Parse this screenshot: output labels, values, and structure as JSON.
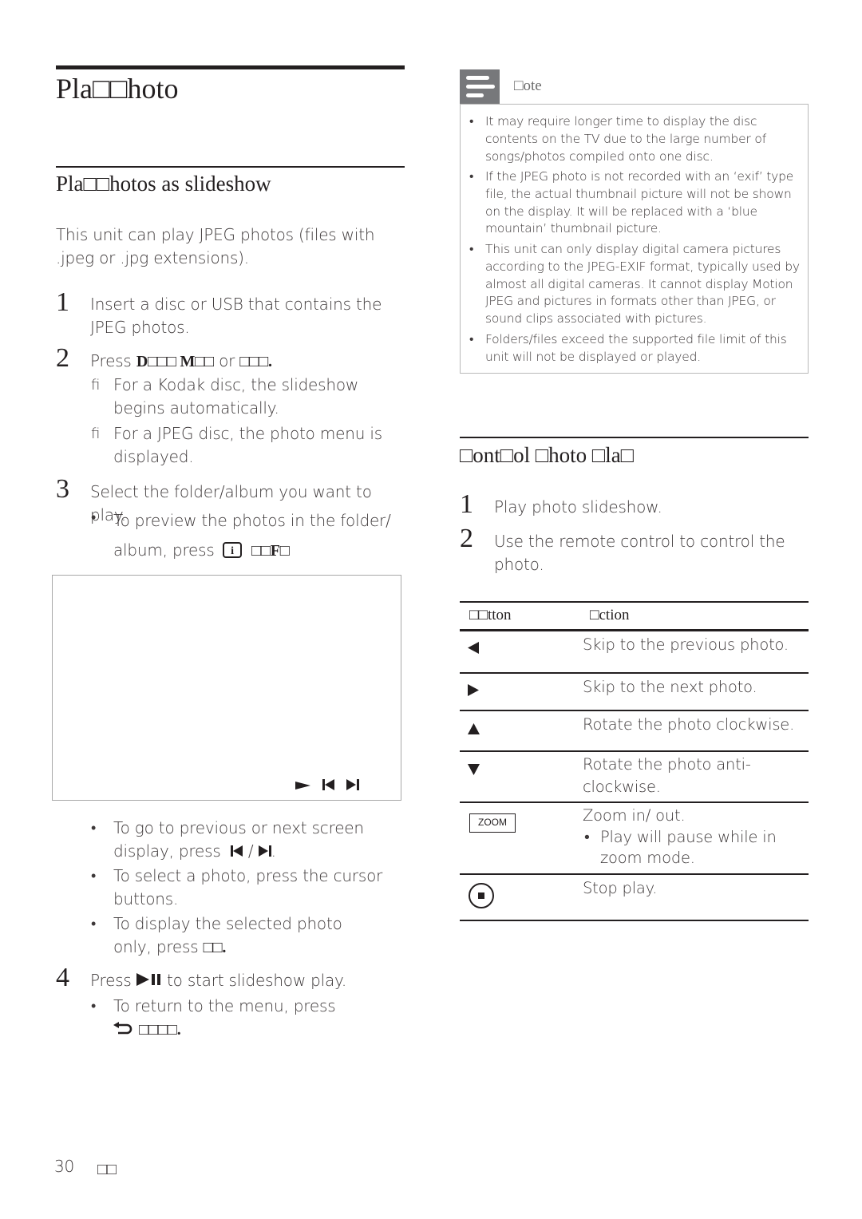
{
  "page": {
    "title": "Pla□□hoto",
    "number": "30",
    "language_label": "□□"
  },
  "slideshow_section": {
    "heading": "Pla□□hotos as slideshow",
    "intro": "This unit can play JPEG photos (files with .jpeg or .jpg extensions).",
    "steps": [
      {
        "number": "1",
        "text": "Insert a disc or USB that contains the JPEG photos."
      },
      {
        "number": "2",
        "text_prefix": "Press",
        "key_1": "D□□□ M□□",
        "connector": "or",
        "key_2": "□□□.",
        "results": [
          {
            "marker": "ﬁ",
            "text": "For a Kodak disc, the slideshow begins automatically."
          },
          {
            "marker": "ﬁ",
            "text": "For a JPEG disc, the photo menu is displayed."
          }
        ]
      },
      {
        "number": "3",
        "text": "Select the folder/album you want to play.",
        "bullets": [
          {
            "text_prefix": "To preview the photos in the folder/ album, press",
            "key_icon": "info-icon",
            "key_label": "□□F□"
          }
        ]
      }
    ],
    "preview_frame": {
      "icons": [
        "play-icon",
        "previous-icon",
        "next-icon"
      ]
    },
    "after_frame_bullets": [
      {
        "text_prefix": "To go to previous or next screen display, press",
        "keys": [
          "previous-icon",
          "next-icon"
        ],
        "separator": "/"
      },
      {
        "text": "To select a photo, press the cursor buttons."
      },
      {
        "text_prefix": "To display the selected photo only, press",
        "key_label": "□□."
      }
    ],
    "step4": {
      "number": "4",
      "text_prefix": "Press",
      "key_icon": "play-pause-icon",
      "text_suffix": "to start slideshow play.",
      "bullets": [
        {
          "text": "To return to the menu, press",
          "key_icon": "back-icon",
          "key_label": "□□□□."
        }
      ]
    }
  },
  "note": {
    "label": "□ote",
    "items": [
      "It may require longer time to display the disc contents on the TV due to the large number of songs/photos compiled onto one disc.",
      "If the JPEG photo is not recorded with an ‘exif’ type file, the actual thumbnail picture will not be shown on the display.  It will be replaced with a ‘blue mountain’ thumbnail picture.",
      "This unit can only display digital camera pictures according to the JPEG-EXIF format, typically used by almost all digital cameras.  It cannot display Motion JPEG and pictures in formats other than JPEG, or sound clips associated with pictures.",
      "Folders/files exceed the supported file limit of this unit will not be displayed or played."
    ]
  },
  "control_section": {
    "heading": "□ont□ol □hoto □la□",
    "steps": [
      {
        "number": "1",
        "text": "Play photo slideshow."
      },
      {
        "number": "2",
        "text": "Use the remote control to control the photo."
      }
    ],
    "table": {
      "headers": [
        "□□tton",
        "□ction"
      ],
      "rows": [
        {
          "button_icon": "left-arrow-icon",
          "action": "Skip to the previous photo."
        },
        {
          "button_icon": "right-arrow-icon",
          "action": "Skip to the next photo."
        },
        {
          "button_icon": "up-arrow-icon",
          "action": "Rotate the photo clockwise."
        },
        {
          "button_icon": "down-arrow-icon",
          "action": "Rotate the photo anti- clockwise."
        },
        {
          "button_icon": "zoom-button",
          "button_label": "ZOOM",
          "action": "Zoom in/ out.",
          "bullet": "Play will pause while in zoom mode."
        },
        {
          "button_icon": "stop-icon",
          "action": "Stop play."
        }
      ]
    }
  }
}
